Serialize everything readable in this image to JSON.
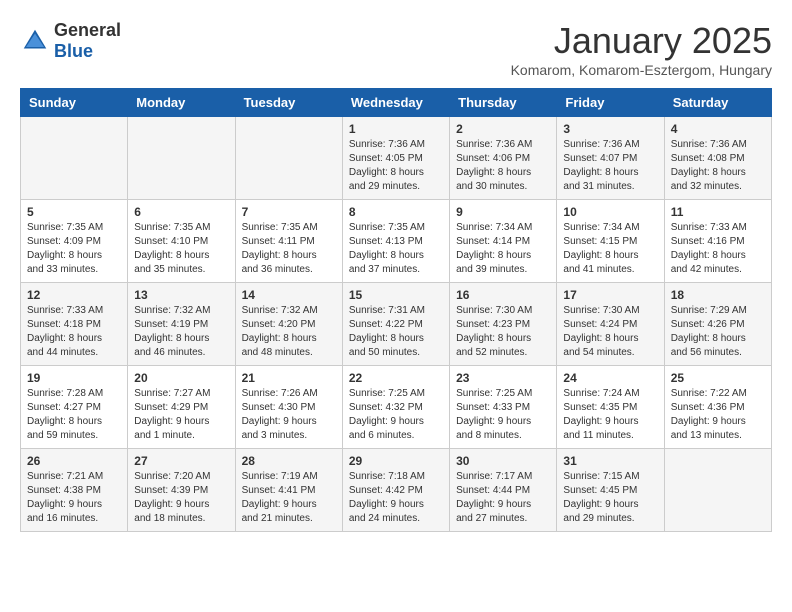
{
  "header": {
    "logo_general": "General",
    "logo_blue": "Blue",
    "month": "January 2025",
    "location": "Komarom, Komarom-Esztergom, Hungary"
  },
  "weekdays": [
    "Sunday",
    "Monday",
    "Tuesday",
    "Wednesday",
    "Thursday",
    "Friday",
    "Saturday"
  ],
  "weeks": [
    [
      {
        "day": "",
        "info": ""
      },
      {
        "day": "",
        "info": ""
      },
      {
        "day": "",
        "info": ""
      },
      {
        "day": "1",
        "info": "Sunrise: 7:36 AM\nSunset: 4:05 PM\nDaylight: 8 hours and 29 minutes."
      },
      {
        "day": "2",
        "info": "Sunrise: 7:36 AM\nSunset: 4:06 PM\nDaylight: 8 hours and 30 minutes."
      },
      {
        "day": "3",
        "info": "Sunrise: 7:36 AM\nSunset: 4:07 PM\nDaylight: 8 hours and 31 minutes."
      },
      {
        "day": "4",
        "info": "Sunrise: 7:36 AM\nSunset: 4:08 PM\nDaylight: 8 hours and 32 minutes."
      }
    ],
    [
      {
        "day": "5",
        "info": "Sunrise: 7:35 AM\nSunset: 4:09 PM\nDaylight: 8 hours and 33 minutes."
      },
      {
        "day": "6",
        "info": "Sunrise: 7:35 AM\nSunset: 4:10 PM\nDaylight: 8 hours and 35 minutes."
      },
      {
        "day": "7",
        "info": "Sunrise: 7:35 AM\nSunset: 4:11 PM\nDaylight: 8 hours and 36 minutes."
      },
      {
        "day": "8",
        "info": "Sunrise: 7:35 AM\nSunset: 4:13 PM\nDaylight: 8 hours and 37 minutes."
      },
      {
        "day": "9",
        "info": "Sunrise: 7:34 AM\nSunset: 4:14 PM\nDaylight: 8 hours and 39 minutes."
      },
      {
        "day": "10",
        "info": "Sunrise: 7:34 AM\nSunset: 4:15 PM\nDaylight: 8 hours and 41 minutes."
      },
      {
        "day": "11",
        "info": "Sunrise: 7:33 AM\nSunset: 4:16 PM\nDaylight: 8 hours and 42 minutes."
      }
    ],
    [
      {
        "day": "12",
        "info": "Sunrise: 7:33 AM\nSunset: 4:18 PM\nDaylight: 8 hours and 44 minutes."
      },
      {
        "day": "13",
        "info": "Sunrise: 7:32 AM\nSunset: 4:19 PM\nDaylight: 8 hours and 46 minutes."
      },
      {
        "day": "14",
        "info": "Sunrise: 7:32 AM\nSunset: 4:20 PM\nDaylight: 8 hours and 48 minutes."
      },
      {
        "day": "15",
        "info": "Sunrise: 7:31 AM\nSunset: 4:22 PM\nDaylight: 8 hours and 50 minutes."
      },
      {
        "day": "16",
        "info": "Sunrise: 7:30 AM\nSunset: 4:23 PM\nDaylight: 8 hours and 52 minutes."
      },
      {
        "day": "17",
        "info": "Sunrise: 7:30 AM\nSunset: 4:24 PM\nDaylight: 8 hours and 54 minutes."
      },
      {
        "day": "18",
        "info": "Sunrise: 7:29 AM\nSunset: 4:26 PM\nDaylight: 8 hours and 56 minutes."
      }
    ],
    [
      {
        "day": "19",
        "info": "Sunrise: 7:28 AM\nSunset: 4:27 PM\nDaylight: 8 hours and 59 minutes."
      },
      {
        "day": "20",
        "info": "Sunrise: 7:27 AM\nSunset: 4:29 PM\nDaylight: 9 hours and 1 minute."
      },
      {
        "day": "21",
        "info": "Sunrise: 7:26 AM\nSunset: 4:30 PM\nDaylight: 9 hours and 3 minutes."
      },
      {
        "day": "22",
        "info": "Sunrise: 7:25 AM\nSunset: 4:32 PM\nDaylight: 9 hours and 6 minutes."
      },
      {
        "day": "23",
        "info": "Sunrise: 7:25 AM\nSunset: 4:33 PM\nDaylight: 9 hours and 8 minutes."
      },
      {
        "day": "24",
        "info": "Sunrise: 7:24 AM\nSunset: 4:35 PM\nDaylight: 9 hours and 11 minutes."
      },
      {
        "day": "25",
        "info": "Sunrise: 7:22 AM\nSunset: 4:36 PM\nDaylight: 9 hours and 13 minutes."
      }
    ],
    [
      {
        "day": "26",
        "info": "Sunrise: 7:21 AM\nSunset: 4:38 PM\nDaylight: 9 hours and 16 minutes."
      },
      {
        "day": "27",
        "info": "Sunrise: 7:20 AM\nSunset: 4:39 PM\nDaylight: 9 hours and 18 minutes."
      },
      {
        "day": "28",
        "info": "Sunrise: 7:19 AM\nSunset: 4:41 PM\nDaylight: 9 hours and 21 minutes."
      },
      {
        "day": "29",
        "info": "Sunrise: 7:18 AM\nSunset: 4:42 PM\nDaylight: 9 hours and 24 minutes."
      },
      {
        "day": "30",
        "info": "Sunrise: 7:17 AM\nSunset: 4:44 PM\nDaylight: 9 hours and 27 minutes."
      },
      {
        "day": "31",
        "info": "Sunrise: 7:15 AM\nSunset: 4:45 PM\nDaylight: 9 hours and 29 minutes."
      },
      {
        "day": "",
        "info": ""
      }
    ]
  ]
}
